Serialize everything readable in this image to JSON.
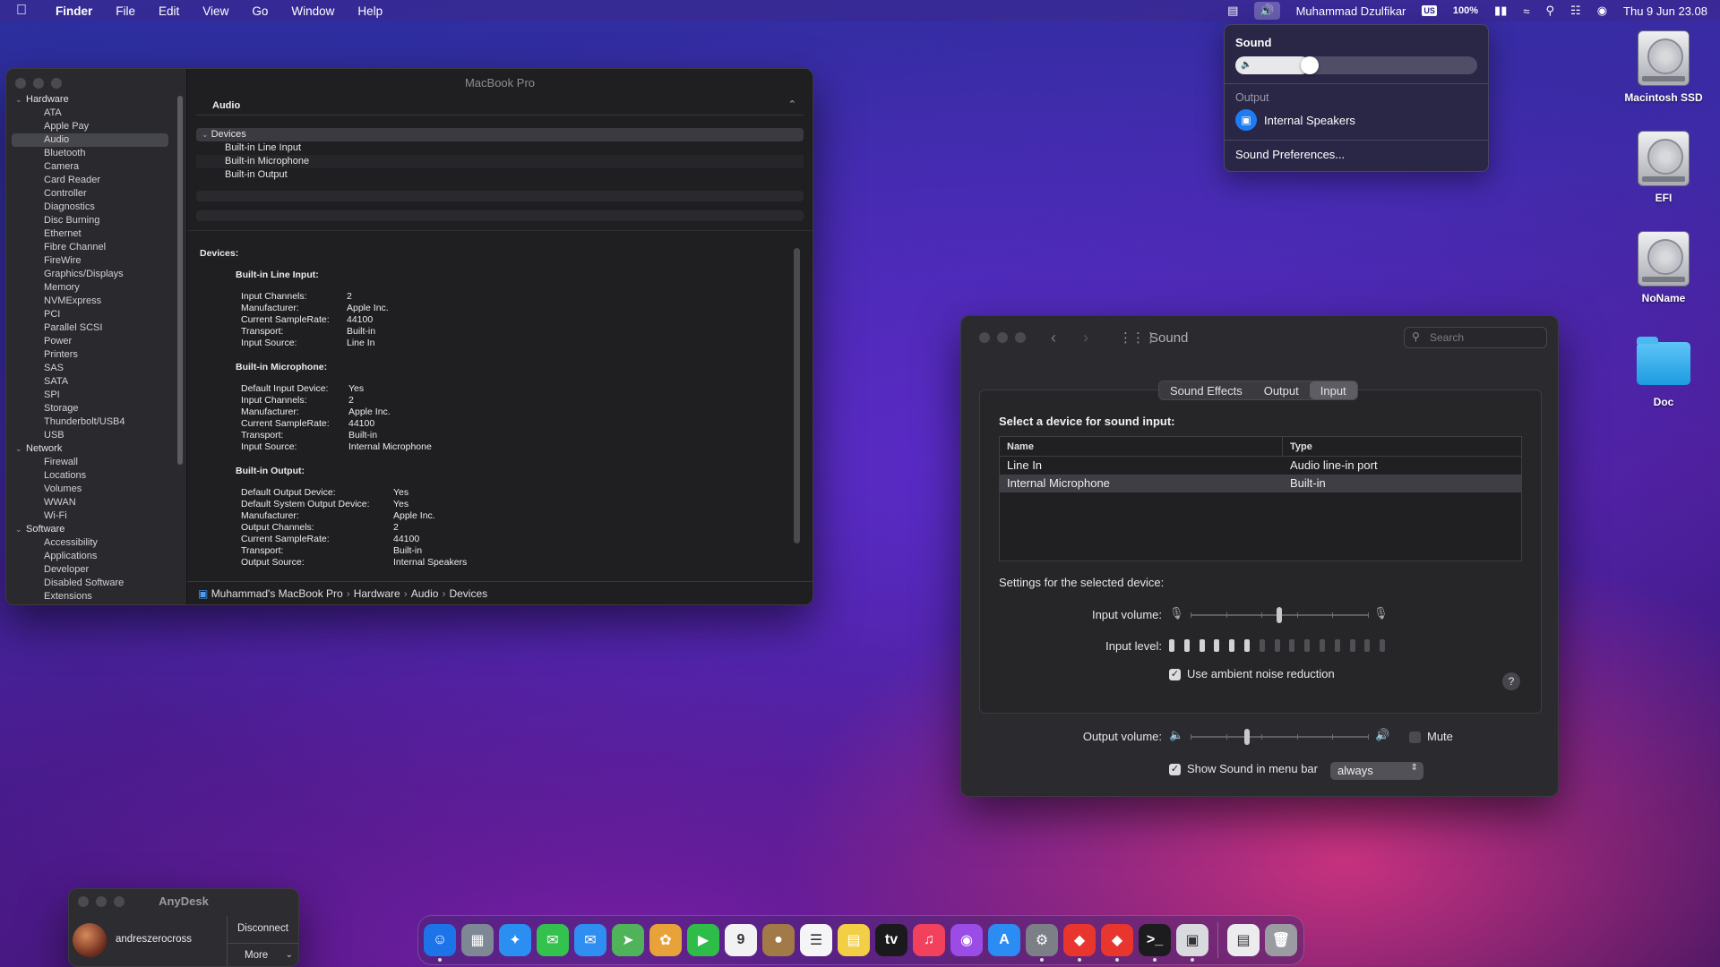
{
  "menubar": {
    "apple": "",
    "app": "Finder",
    "menus": [
      "File",
      "Edit",
      "View",
      "Go",
      "Window",
      "Help"
    ],
    "user": "Muhammad Dzulfikar",
    "input_source": "US",
    "battery": "100%",
    "datetime": "Thu 9 Jun  23.08"
  },
  "sound_menu": {
    "title": "Sound",
    "volume_fraction": 0.27,
    "output_section": "Output",
    "output_device": "Internal Speakers",
    "prefs_link": "Sound Preferences..."
  },
  "desktop": {
    "icons": [
      "Macintosh SSD",
      "EFI",
      "NoName",
      "Doc"
    ]
  },
  "sysinfo": {
    "window_title": "MacBook Pro",
    "sidebar": {
      "hardware": "Hardware",
      "hardware_items": [
        "ATA",
        "Apple Pay",
        "Audio",
        "Bluetooth",
        "Camera",
        "Card Reader",
        "Controller",
        "Diagnostics",
        "Disc Burning",
        "Ethernet",
        "Fibre Channel",
        "FireWire",
        "Graphics/Displays",
        "Memory",
        "NVMExpress",
        "PCI",
        "Parallel SCSI",
        "Power",
        "Printers",
        "SAS",
        "SATA",
        "SPI",
        "Storage",
        "Thunderbolt/USB4",
        "USB"
      ],
      "network": "Network",
      "network_items": [
        "Firewall",
        "Locations",
        "Volumes",
        "WWAN",
        "Wi-Fi"
      ],
      "software": "Software",
      "software_items": [
        "Accessibility",
        "Applications",
        "Developer",
        "Disabled Software",
        "Extensions"
      ],
      "selected": "Audio"
    },
    "section_header": "Audio",
    "tree": {
      "group": "Devices",
      "items": [
        "Built-in Line Input",
        "Built-in Microphone",
        "Built-in Output"
      ]
    },
    "detail": {
      "heading": "Devices:",
      "line_input": {
        "title": "Built-in Line Input:",
        "rows": [
          [
            "Input Channels:",
            "2"
          ],
          [
            "Manufacturer:",
            "Apple Inc."
          ],
          [
            "Current SampleRate:",
            "44100"
          ],
          [
            "Transport:",
            "Built-in"
          ],
          [
            "Input Source:",
            "Line In"
          ]
        ]
      },
      "microphone": {
        "title": "Built-in Microphone:",
        "rows": [
          [
            "Default Input Device:",
            "Yes"
          ],
          [
            "Input Channels:",
            "2"
          ],
          [
            "Manufacturer:",
            "Apple Inc."
          ],
          [
            "Current SampleRate:",
            "44100"
          ],
          [
            "Transport:",
            "Built-in"
          ],
          [
            "Input Source:",
            "Internal Microphone"
          ]
        ]
      },
      "output": {
        "title": "Built-in Output:",
        "rows": [
          [
            "Default Output Device:",
            "Yes"
          ],
          [
            "Default System Output Device:",
            "Yes"
          ],
          [
            "Manufacturer:",
            "Apple Inc."
          ],
          [
            "Output Channels:",
            "2"
          ],
          [
            "Current SampleRate:",
            "44100"
          ],
          [
            "Transport:",
            "Built-in"
          ],
          [
            "Output Source:",
            "Internal Speakers"
          ]
        ]
      }
    },
    "breadcrumb": [
      "Muhammad's MacBook Pro",
      "Hardware",
      "Audio",
      "Devices"
    ]
  },
  "sound_prefs": {
    "title": "Sound",
    "search_placeholder": "Search",
    "tabs": [
      "Sound Effects",
      "Output",
      "Input"
    ],
    "active_tab": "Input",
    "select_label": "Select a device for sound input:",
    "columns": [
      "Name",
      "Type"
    ],
    "devices": [
      [
        "Line In",
        "Audio line-in port"
      ],
      [
        "Internal Microphone",
        "Built-in"
      ]
    ],
    "selected_device": 1,
    "settings_label": "Settings for the selected device:",
    "input_volume_label": "Input volume:",
    "input_volume_fraction": 0.5,
    "input_level_label": "Input level:",
    "input_level_bars": 15,
    "input_level_active": 6,
    "ambient_label": "Use ambient noise reduction",
    "ambient_checked": true,
    "help": "?",
    "output_volume_label": "Output volume:",
    "output_volume_fraction": 0.32,
    "mute_label": "Mute",
    "mute_checked": false,
    "show_menubar_label": "Show Sound in menu bar",
    "show_menubar_checked": true,
    "show_menubar_value": "always"
  },
  "anydesk": {
    "title": "AnyDesk",
    "user": "andreszerocross",
    "disconnect": "Disconnect",
    "more": "More"
  },
  "dock": {
    "apps": [
      {
        "name": "finder-icon",
        "color": "#1d74e8",
        "glyph": "☺",
        "running": true
      },
      {
        "name": "launchpad-icon",
        "color": "#7e8794",
        "glyph": "▦",
        "running": false
      },
      {
        "name": "safari-icon",
        "color": "#2a8ff0",
        "glyph": "✦",
        "running": false
      },
      {
        "name": "messages-icon",
        "color": "#33c24d",
        "glyph": "✉",
        "running": false
      },
      {
        "name": "mail-icon",
        "color": "#2f8ef2",
        "glyph": "✉",
        "running": false
      },
      {
        "name": "maps-icon",
        "color": "#4fb35a",
        "glyph": "➤",
        "running": false
      },
      {
        "name": "photos-icon",
        "color": "#e8a23a",
        "glyph": "✿",
        "running": false
      },
      {
        "name": "facetime-icon",
        "color": "#2fbd49",
        "glyph": "▶",
        "running": false
      },
      {
        "name": "calendar-icon",
        "color": "#f2f2f4",
        "glyph": "9",
        "running": false
      },
      {
        "name": "contacts-icon",
        "color": "#a27a48",
        "glyph": "●",
        "running": false
      },
      {
        "name": "reminders-icon",
        "color": "#f5f5f7",
        "glyph": "☰",
        "running": false
      },
      {
        "name": "notes-icon",
        "color": "#f2cf45",
        "glyph": "▤",
        "running": false
      },
      {
        "name": "tv-icon",
        "color": "#1a1a1c",
        "glyph": "tv",
        "running": false
      },
      {
        "name": "music-icon",
        "color": "#f2415c",
        "glyph": "♫",
        "running": false
      },
      {
        "name": "podcasts-icon",
        "color": "#9b4ce6",
        "glyph": "◉",
        "running": false
      },
      {
        "name": "app-store-icon",
        "color": "#2b8cf3",
        "glyph": "A",
        "running": false
      },
      {
        "name": "system-preferences-icon",
        "color": "#7c7f86",
        "glyph": "⚙",
        "running": true
      },
      {
        "name": "anydesk-icon",
        "color": "#e8362f",
        "glyph": "◆",
        "running": true
      },
      {
        "name": "anydesk-alt-icon",
        "color": "#e8362f",
        "glyph": "◆",
        "running": true
      },
      {
        "name": "terminal-icon",
        "color": "#1c1c1e",
        "glyph": ">_",
        "running": true
      },
      {
        "name": "system-info-icon",
        "color": "#d9dade",
        "glyph": "▣",
        "running": true
      }
    ],
    "trailing": [
      {
        "name": "document-icon",
        "color": "#ececef",
        "glyph": "▤"
      },
      {
        "name": "trash-icon",
        "color": "#9a9ca2",
        "glyph": "🗑"
      }
    ]
  }
}
